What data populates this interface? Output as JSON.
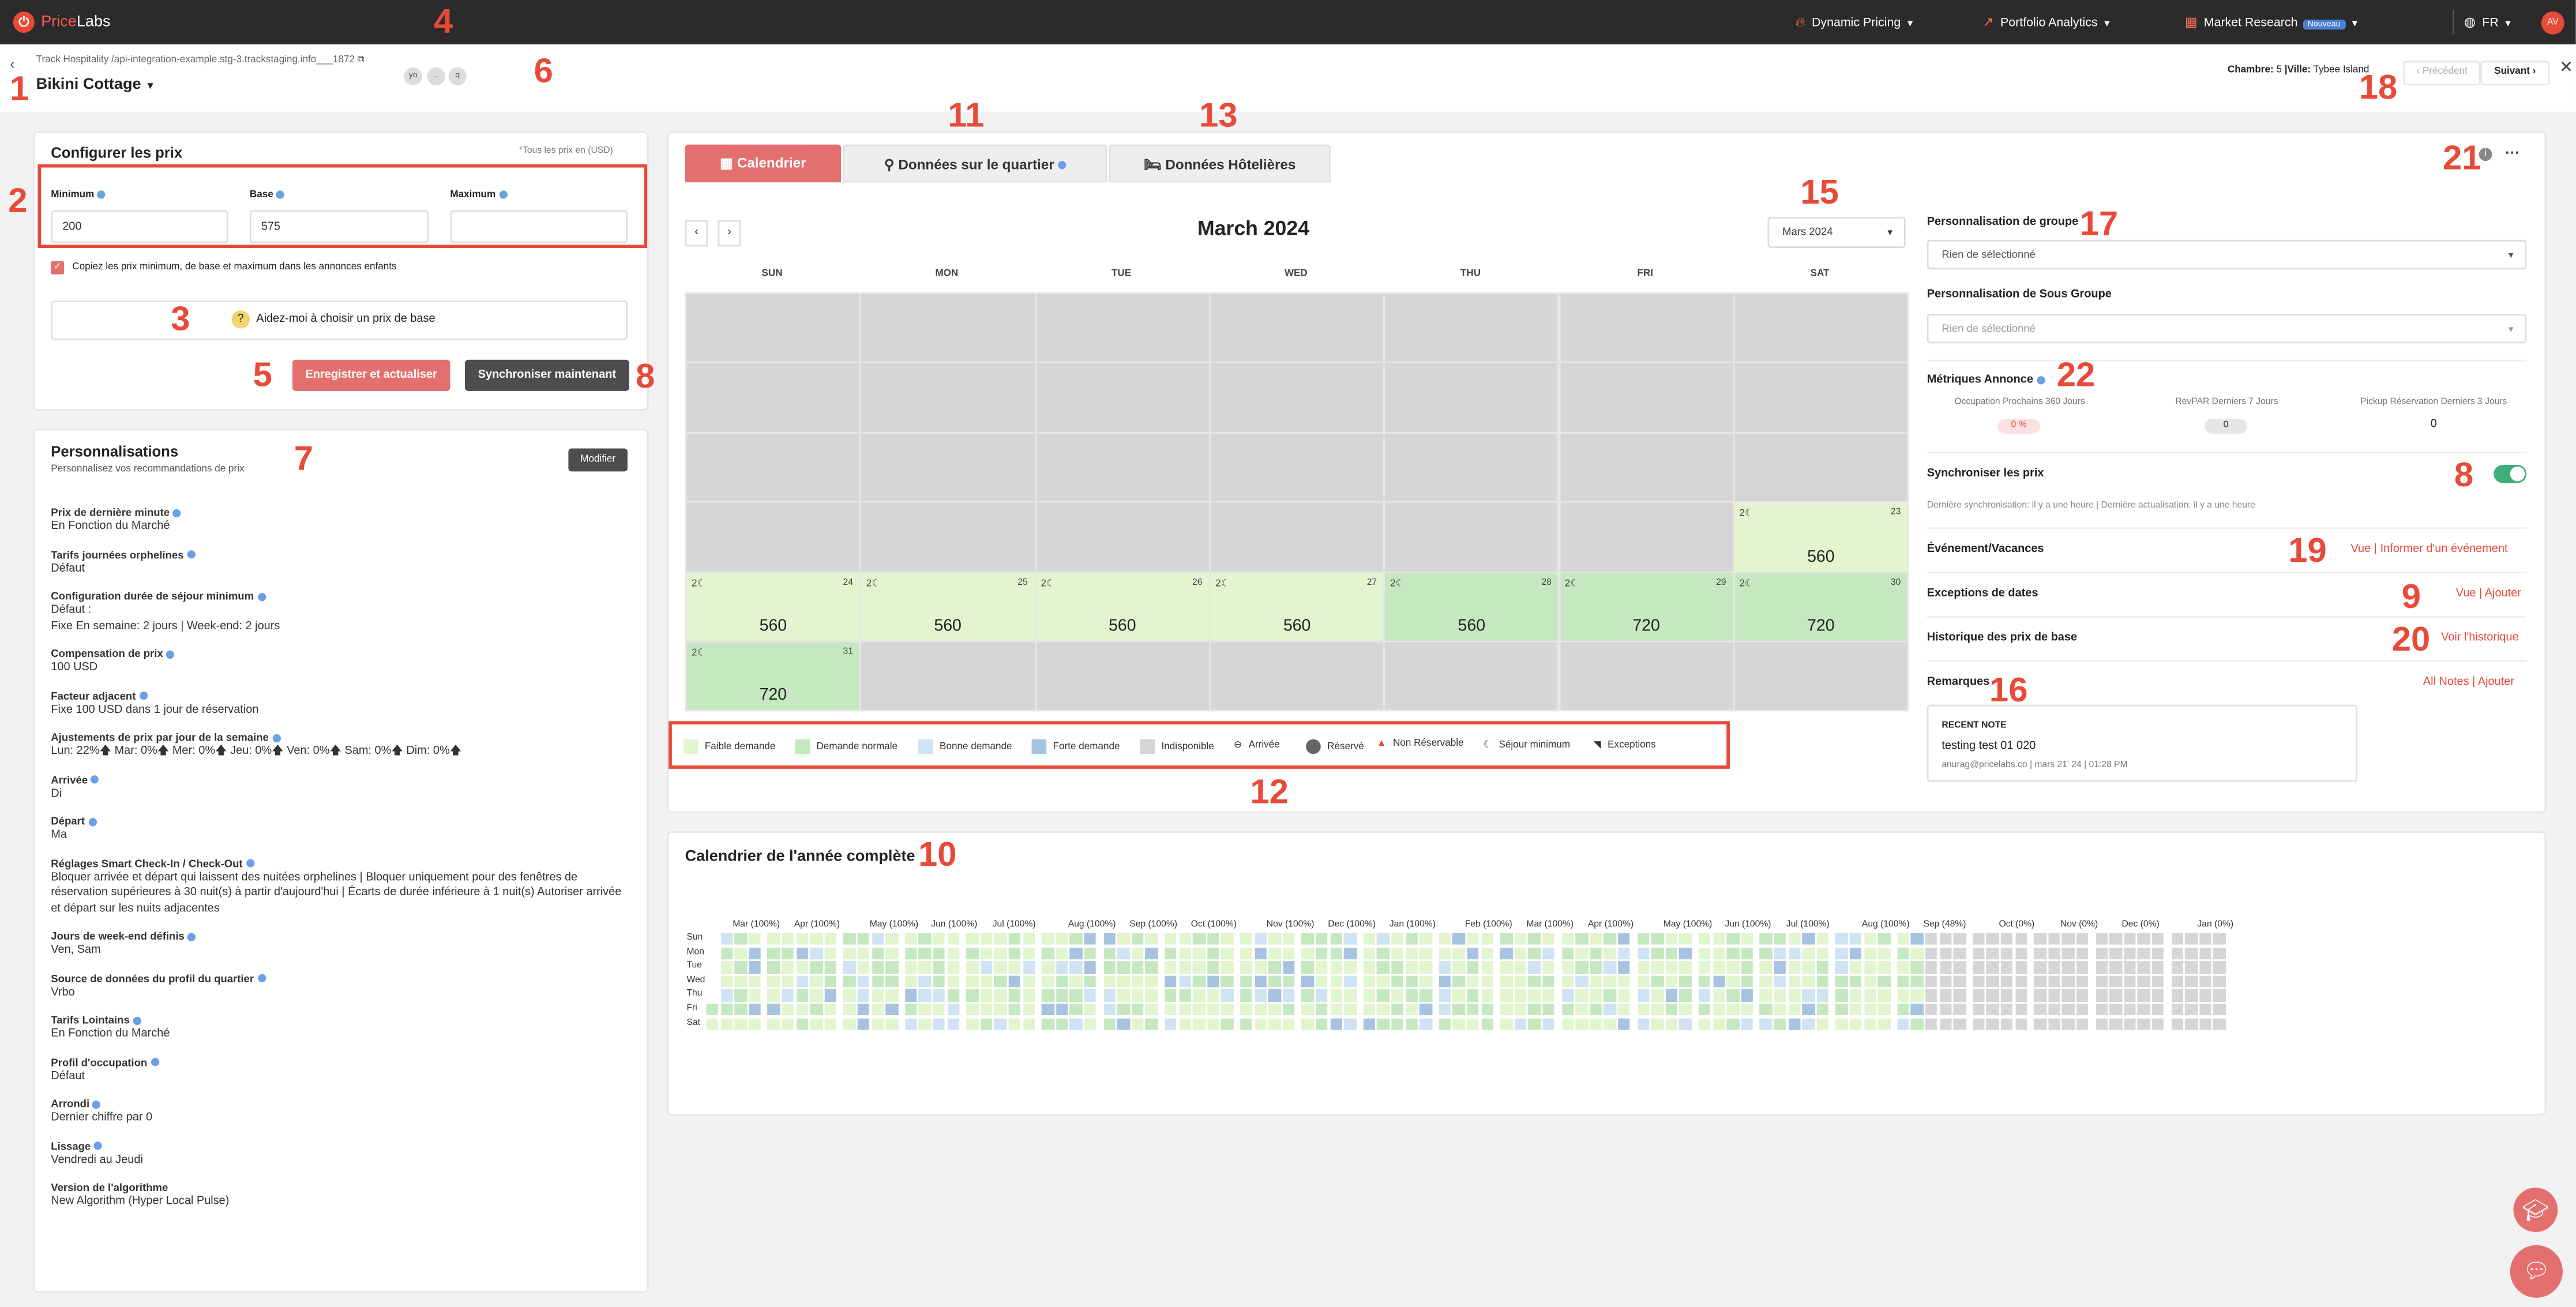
{
  "topnav": {
    "logo_price": "Price",
    "logo_labs": "Labs",
    "dynamic_pricing": "Dynamic Pricing",
    "portfolio_analytics": "Portfolio Analytics",
    "market_research": "Market Research",
    "new_badge": "Nouveau",
    "lang": "FR",
    "avatar": "AV"
  },
  "header": {
    "breadcrumb": "Track Hospitality /api-integration-example.stg-3.trackstaging.info___1872",
    "title": "Bikini Cottage",
    "chips": [
      "yo",
      "..",
      "q"
    ],
    "room_label": "Chambre:",
    "room_value": "5",
    "city_label": "|Ville:",
    "city_value": "Tybee Island",
    "prev": "Précédent",
    "next": "Suivant"
  },
  "configure": {
    "title": "Configurer les prix",
    "currency_note": "*Tous les prix en (USD)",
    "minimum_label": "Minimum",
    "minimum_value": "200",
    "base_label": "Base",
    "base_value": "575",
    "maximum_label": "Maximum",
    "maximum_value": "",
    "copy_checkbox": "Copiez les prix minimum, de base et maximum dans les annonces enfants",
    "help_base": "Aidez-moi à choisir un prix de base",
    "save_button": "Enregistrer et actualiser",
    "sync_button": "Synchroniser maintenant"
  },
  "customizations": {
    "title": "Personnalisations",
    "subtitle": "Personnalisez vos recommandations de prix",
    "modify_button": "Modifier",
    "items": [
      {
        "label": "Prix de dernière minute",
        "value": "En Fonction du Marché"
      },
      {
        "label": "Tarifs journées orphelines",
        "value": "Défaut"
      },
      {
        "label": "Configuration durée de séjour minimum",
        "value": "Défaut :",
        "value2": "Fixe En semaine: 2 jours | Week-end: 2 jours"
      },
      {
        "label": "Compensation de prix",
        "value": "100 USD"
      },
      {
        "label": "Facteur adjacent",
        "value": "Fixe 100 USD dans 1 jour de réservation"
      },
      {
        "label": "Ajustements de prix par jour de la semaine",
        "value": "Lun: 22%🡅 Mar: 0%🡅 Mer: 0%🡅 Jeu: 0%🡅 Ven: 0%🡅 Sam: 0%🡅 Dim: 0%🡅"
      },
      {
        "label": "Arrivée",
        "value": "Di"
      },
      {
        "label": "Départ",
        "value": "Ma"
      },
      {
        "label": "Réglages Smart Check-In / Check-Out",
        "value": "Bloquer arrivée et départ qui laissent des nuitées orphelines | Bloquer uniquement pour des fenêtres de réservation supérieures à 30 nuit(s) à partir d'aujourd'hui | Écarts de durée inférieure à 1 nuit(s) Autoriser arrivée et départ sur les nuits adjacentes"
      },
      {
        "label": "Jours de week-end définis",
        "value": "Ven, Sam"
      },
      {
        "label": "Source de données du profil du quartier",
        "value": "Vrbo"
      },
      {
        "label": "Tarifs Lointains",
        "value": "En Fonction du Marché"
      },
      {
        "label": "Profil d'occupation",
        "value": "Défaut"
      },
      {
        "label": "Arrondi",
        "value": "Dernier chiffre par 0"
      },
      {
        "label": "Lissage",
        "value": "Vendredi au Jeudi"
      },
      {
        "label": "Version de l'algorithme",
        "value": "New Algorithm (Hyper Local Pulse)"
      }
    ]
  },
  "tabs": {
    "calendar": "Calendrier",
    "neighborhood": "Données sur le quartier",
    "hotel": "Données Hôtelières"
  },
  "calendar": {
    "month_title": "March 2024",
    "month_select": "Mars 2024",
    "weekdays": [
      "SUN",
      "MON",
      "TUE",
      "WED",
      "THU",
      "FRI",
      "SAT"
    ],
    "los_mark": "2☾",
    "cells": [
      {
        "day": "23",
        "price": "560",
        "status": "low"
      },
      {
        "day": "24",
        "price": "560",
        "status": "low"
      },
      {
        "day": "25",
        "price": "560",
        "status": "low"
      },
      {
        "day": "26",
        "price": "560",
        "status": "low"
      },
      {
        "day": "27",
        "price": "560",
        "status": "low"
      },
      {
        "day": "28",
        "price": "560",
        "status": "normal"
      },
      {
        "day": "29",
        "price": "720",
        "status": "normal"
      },
      {
        "day": "30",
        "price": "720",
        "status": "normal"
      },
      {
        "day": "31",
        "price": "720",
        "status": "normal"
      }
    ]
  },
  "legend": {
    "low": "Faible demande",
    "normal": "Demande normale",
    "good": "Bonne demande",
    "high": "Forte demande",
    "unavailable": "Indisponible",
    "arrival": "Arrivée",
    "booked": "Réservé",
    "nonrefundable": "Non Réservable",
    "minstay": "Séjour minimum",
    "exceptions": "Exceptions"
  },
  "right_panel": {
    "group_title": "Personnalisation de groupe",
    "group_select": "Rien de sélectionné",
    "subgroup_title": "Personnalisation de Sous Groupe",
    "subgroup_select": "Rien de sélectionné",
    "metrics_title": "Métriques Annonce",
    "metric1_label": "Occupation Prochains 360 Jours",
    "metric1_value": "0 %",
    "metric2_label": "RevPAR Derniers 7 Jours",
    "metric2_value": "0",
    "metric3_label": "Pickup Réservation Derniers 3 Jours",
    "metric3_value": "0",
    "sync_title": "Synchroniser les prix",
    "sync_note": "Dernière synchronisation: il y a une heure | Dernière actualisation: il y a une heure",
    "events_title": "Événement/Vacances",
    "events_view": "Vue",
    "events_report": "Informer d'un événement",
    "date_exc_title": "Exceptions de dates",
    "date_exc_view": "Vue",
    "date_exc_add": "Ajouter",
    "base_hist_title": "Historique des prix de base",
    "base_hist_link": "Voir l'historique",
    "notes_title": "Remarques",
    "notes_all": "All Notes",
    "notes_add": "Ajouter",
    "recent_note_label": "RECENT NOTE",
    "recent_note_text": "testing test 01 020",
    "recent_note_meta": "anurag@pricelabs.co | mars 21' 24 | 01:28 PM"
  },
  "year_calendar": {
    "title": "Calendrier de l'année complète",
    "days": [
      "Sun",
      "Mon",
      "Tue",
      "Wed",
      "Thu",
      "Fri",
      "Sat"
    ],
    "months": [
      "Mar (100%)",
      "Apr (100%)",
      "May (100%)",
      "Jun (100%)",
      "Jul (100%)",
      "Aug (100%)",
      "Sep (100%)",
      "Oct (100%)",
      "Nov (100%)",
      "Dec (100%)",
      "Jan (100%)",
      "Feb (100%)",
      "Mar (100%)",
      "Apr (100%)",
      "May (100%)",
      "Jun (100%)",
      "Jul (100%)",
      "Aug (100%)",
      "Sep (48%)",
      "Oct (0%)",
      "Nov (0%)",
      "Dec (0%)",
      "Jan (0%)"
    ]
  },
  "annotations": [
    "1",
    "2",
    "3",
    "4",
    "5",
    "6",
    "7",
    "8",
    "8",
    "9",
    "10",
    "11",
    "12",
    "13",
    "15",
    "16",
    "17",
    "18",
    "19",
    "20",
    "21",
    "22"
  ],
  "colors": {
    "accent": "#e84a3a",
    "low": "#e2f5cf",
    "normal": "#c6e8c0",
    "good": "#cfe3f3",
    "high": "#a7c3e0",
    "unavailable": "#d6d6d6"
  }
}
